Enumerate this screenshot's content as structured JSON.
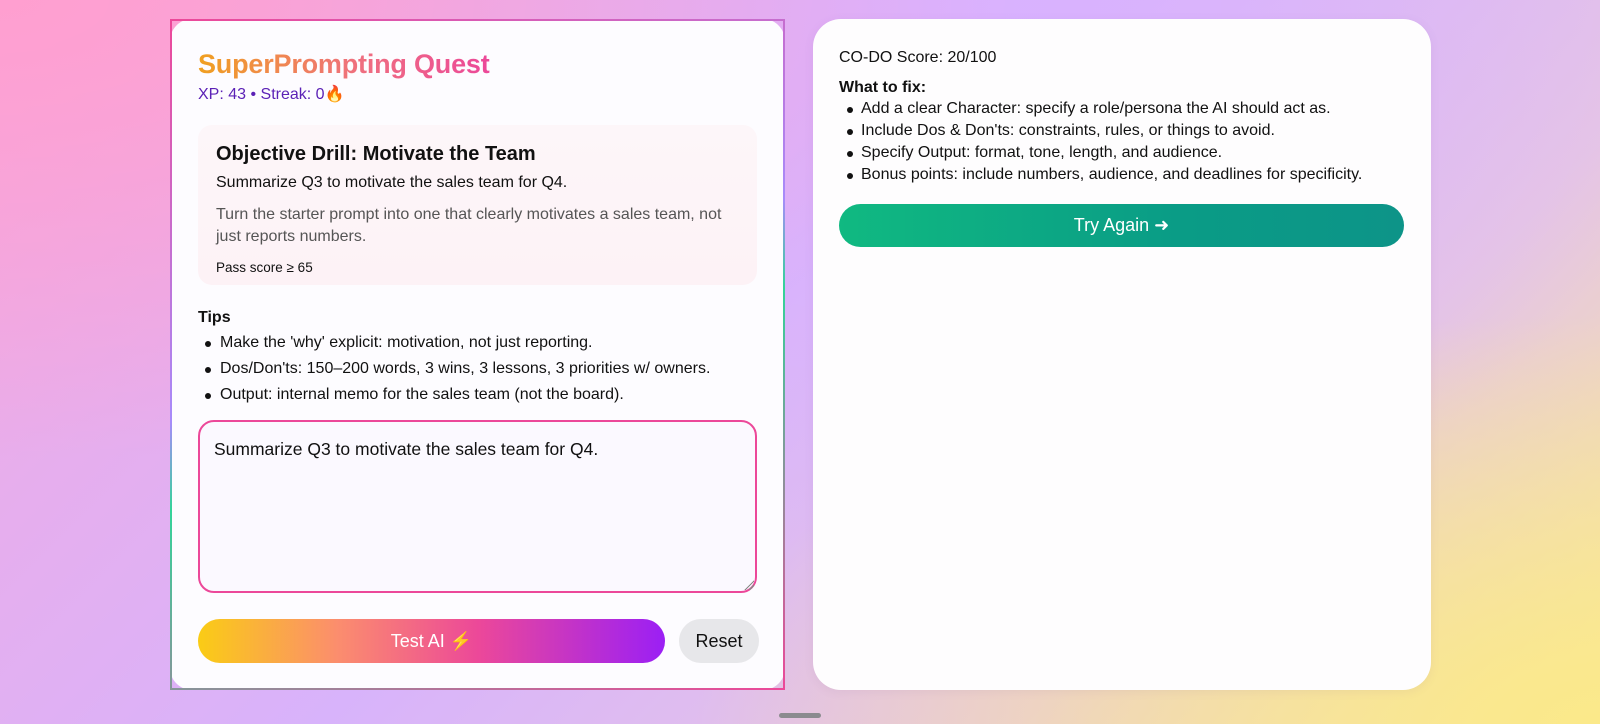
{
  "app": {
    "title": "SuperPrompting Quest",
    "stats": "XP: 43 • Streak: 0🔥"
  },
  "drill": {
    "title": "Objective Drill: Motivate the Team",
    "starter_prompt": "Summarize Q3 to motivate the sales team for Q4.",
    "description": "Turn the starter prompt into one that clearly motivates a sales team, not just reports numbers.",
    "pass_score": "Pass score ≥ 65"
  },
  "tips": {
    "heading": "Tips",
    "items": [
      "Make the 'why' explicit: motivation, not just reporting.",
      "Dos/Don'ts: 150–200 words, 3 wins, 3 lessons, 3 priorities w/ owners.",
      "Output: internal memo for the sales team (not the board)."
    ]
  },
  "editor": {
    "value": "Summarize Q3 to motivate the sales team for Q4."
  },
  "buttons": {
    "test": "Test AI ⚡",
    "reset": "Reset",
    "try_again": "Try Again ➜"
  },
  "result": {
    "score": "CO-DO Score: 20/100",
    "fix_heading": "What to fix:",
    "fixes": [
      "Add a clear Character: specify a role/persona the AI should act as.",
      "Include Dos & Don'ts: constraints, rules, or things to avoid.",
      "Specify Output: format, tone, length, and audience.",
      "Bonus points: include numbers, audience, and deadlines for specificity."
    ]
  },
  "colors": {
    "accent_pink": "#ec4899",
    "accent_green": "#10b981",
    "stats_purple": "#5b21b6"
  }
}
